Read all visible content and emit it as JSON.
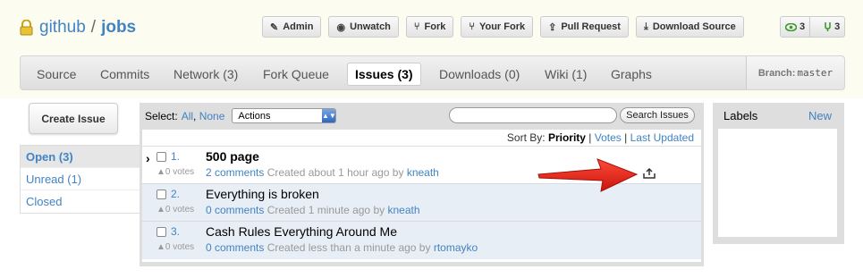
{
  "repo": {
    "owner": "github",
    "separator": "/",
    "name": "jobs"
  },
  "actions": [
    {
      "label": "Admin",
      "icon": "wrench-icon",
      "glyph": "✎"
    },
    {
      "label": "Unwatch",
      "icon": "eye-icon",
      "glyph": "◉"
    },
    {
      "label": "Fork",
      "icon": "fork-icon",
      "glyph": "⑂"
    },
    {
      "label": "Your Fork",
      "icon": "fork-icon",
      "glyph": "⑂"
    },
    {
      "label": "Pull Request",
      "icon": "pull-request-icon",
      "glyph": "⇪"
    },
    {
      "label": "Download Source",
      "icon": "download-icon",
      "glyph": "⤓"
    }
  ],
  "counters": {
    "watchers": "3",
    "forks": "3"
  },
  "tabs": [
    {
      "label": "Source",
      "active": false
    },
    {
      "label": "Commits",
      "active": false
    },
    {
      "label": "Network (3)",
      "active": false
    },
    {
      "label": "Fork Queue",
      "active": false
    },
    {
      "label": "Issues (3)",
      "active": true
    },
    {
      "label": "Downloads (0)",
      "active": false
    },
    {
      "label": "Wiki (1)",
      "active": false
    },
    {
      "label": "Graphs",
      "active": false
    }
  ],
  "branch": {
    "label": "Branch:",
    "value": "master"
  },
  "sidebar": {
    "create_label": "Create Issue",
    "filters": [
      {
        "label": "Open (3)",
        "active": true
      },
      {
        "label": "Unread (1)",
        "active": false
      },
      {
        "label": "Closed",
        "active": false
      }
    ]
  },
  "toolbar": {
    "select_label": "Select:",
    "select_all": "All",
    "select_comma": ",",
    "select_none": "None",
    "actions_value": "Actions",
    "search_value": "",
    "search_button": "Search Issues"
  },
  "sort": {
    "label": "Sort By:",
    "priority": "Priority",
    "sep1": "|",
    "votes": "Votes",
    "sep2": "|",
    "last_updated": "Last Updated"
  },
  "issues": [
    {
      "number": "1.",
      "title": "500 page",
      "votes": "0 votes",
      "comments": "2 comments",
      "created": "Created about 1 hour ago by",
      "author": "kneath"
    },
    {
      "number": "2.",
      "title": "Everything is broken",
      "votes": "0 votes",
      "comments": "0 comments",
      "created": "Created 1 minute ago by",
      "author": "kneath"
    },
    {
      "number": "3.",
      "title": "Cash Rules Everything Around Me",
      "votes": "0 votes",
      "comments": "0 comments",
      "created": "Created less than a minute ago by",
      "author": "rtomayko"
    }
  ],
  "labels": {
    "heading": "Labels",
    "new_label": "New"
  },
  "colors": {
    "link": "#4183c4",
    "header_bg": "#fdfcf0",
    "arrow": "#e8241b",
    "row_alt": "#e8eef5"
  }
}
